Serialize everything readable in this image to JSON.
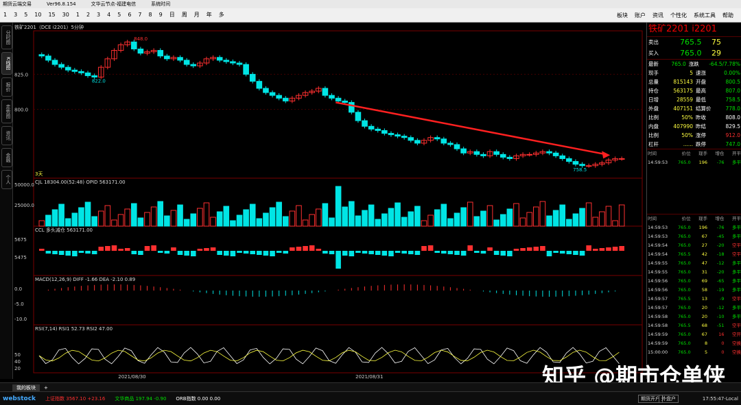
{
  "colors": {
    "up": "#ff3030",
    "down": "#00e5e5",
    "ma": "#ffffff",
    "yellow": "#ffff40",
    "bg": "#000000",
    "grid": "#7a0000"
  },
  "title": {
    "app": "期货云端交易",
    "version": "Ver96.8.154",
    "news": "文华云节点-福建电信",
    "sysinfo": "系统时间"
  },
  "toolbar": {
    "buttons": [
      "1",
      "3",
      "5",
      "10",
      "15",
      "30",
      "1",
      "2",
      "3",
      "4",
      "5",
      "6",
      "7",
      "8",
      "9",
      "日",
      "周",
      "月",
      "年",
      "多"
    ],
    "right": [
      "板块",
      "账户",
      "资讯",
      "个性化",
      "系统工具",
      "帮助"
    ]
  },
  "left_tabs": [
    "分时图",
    "K线图",
    "报价",
    "走势图",
    "资讯",
    "金融",
    "个人"
  ],
  "chart": {
    "instrument_label": "铁矿2201（DCE i2201）5分钟",
    "price_ticks": [
      "825.0",
      "800.0"
    ],
    "high_label": "848.0",
    "low_label": "822.0",
    "low2_label": "758.5",
    "bottom_label": "3天",
    "vol_header": "CJL    18304.00(52:48)  OPID 563171.00",
    "vol_ticks": [
      "50000.0",
      "25000.0"
    ],
    "ccl_header": "CCL    多头减仓    563171.00",
    "ccl_ticks": [
      "5675",
      "5475"
    ],
    "macd_header": "MACD(12,26,9)   DIFF -1.66   DEA -2.10   0.89",
    "macd_ticks": [
      "0.0",
      "-5.0",
      "-10.0"
    ],
    "rsi_header": "RSI(7,14)   RSI1 52.73   RSI2 47.00",
    "rsi_ticks": [
      "50",
      "40",
      "20"
    ],
    "dates": [
      "2021/08/30",
      "2021/08/31"
    ]
  },
  "chart_data": {
    "type": "candlestick",
    "note": "5-minute candles, i2201 iron ore",
    "price_range": [
      755,
      852
    ],
    "closes": [
      838,
      835,
      832,
      830,
      828,
      827,
      826,
      824,
      823,
      830,
      836,
      842,
      846,
      848,
      843,
      840,
      841,
      842,
      838,
      836,
      837,
      835,
      832,
      831,
      833,
      836,
      837,
      835,
      834,
      833,
      832,
      825,
      820,
      815,
      812,
      810,
      808,
      806,
      808,
      810,
      812,
      813,
      815,
      810,
      808,
      806,
      805,
      798,
      792,
      788,
      786,
      785,
      783,
      782,
      781,
      780,
      778,
      776,
      778,
      780,
      779,
      776,
      775,
      772,
      769,
      770,
      768,
      767,
      770,
      768,
      766,
      765,
      767,
      768,
      768,
      769,
      770,
      769,
      767,
      765,
      763,
      761,
      760,
      760,
      761,
      762,
      764,
      765,
      765
    ]
  },
  "right_panel": {
    "title": "铁矿2201   i2201",
    "sell": {
      "label": "卖出",
      "price": "765.5",
      "qty": "75"
    },
    "buy": {
      "label": "买入",
      "price": "765.0",
      "qty": "29"
    },
    "stats": [
      [
        "最新",
        "765.0",
        "涨跌",
        "-64.5/7.78%"
      ],
      [
        "现手",
        "5",
        "速涨",
        "0.00%"
      ],
      [
        "总量",
        "815143",
        "开盘",
        "800.5"
      ],
      [
        "持仓",
        "563175",
        "最高",
        "807.0"
      ],
      [
        "日增",
        "28559",
        "最低",
        "758.5"
      ],
      [
        "外盘",
        "407151",
        "结算价",
        "778.0"
      ],
      [
        "比例",
        "50%",
        "昨收",
        "808.0"
      ],
      [
        "内盘",
        "407990",
        "昨结",
        "829.5"
      ],
      [
        "比例",
        "50%",
        "涨停",
        "912.0"
      ],
      [
        "杠杆",
        "......",
        "跌停",
        "747.0"
      ]
    ],
    "trade_header": [
      "时间",
      "价位",
      "现手",
      "增仓",
      "开平"
    ],
    "top_trade": [
      "14:59:53",
      "765.0",
      "196",
      "-76",
      "多平"
    ],
    "trades": [
      [
        "14:59:53",
        "765.0",
        "196",
        "-76",
        "多平"
      ],
      [
        "14:59:53",
        "765.0",
        "67",
        "-45",
        "多平"
      ],
      [
        "14:59:54",
        "765.0",
        "27",
        "-20",
        "空平"
      ],
      [
        "14:59:54",
        "765.5",
        "42",
        "-18",
        "空平"
      ],
      [
        "14:59:55",
        "765.0",
        "47",
        "-12",
        "多平"
      ],
      [
        "14:59:55",
        "765.0",
        "31",
        "-20",
        "多平"
      ],
      [
        "14:59:56",
        "765.0",
        "69",
        "-65",
        "多平"
      ],
      [
        "14:59:56",
        "765.0",
        "58",
        "-19",
        "多平"
      ],
      [
        "14:59:57",
        "765.5",
        "13",
        "-9",
        "空平"
      ],
      [
        "14:59:57",
        "765.0",
        "20",
        "-12",
        "多平"
      ],
      [
        "14:59:58",
        "765.0",
        "20",
        "-10",
        "多平"
      ],
      [
        "14:59:58",
        "765.5",
        "68",
        "-51",
        "空平"
      ],
      [
        "14:59:59",
        "765.0",
        "67",
        "16",
        "空开"
      ],
      [
        "14:59:59",
        "765.0",
        "8",
        "0",
        "空换"
      ],
      [
        "15:00:00",
        "765.0",
        "5",
        "0",
        "空换"
      ]
    ]
  },
  "tabs": {
    "active": "我的板块",
    "add": "+"
  },
  "status": {
    "logo": "webstock",
    "sh": "上证指数  3567.10  +23.16",
    "wh": "文华商品  197.94  -0.90",
    "orb": "ORB指数  0.00  0.00",
    "btn1": "期货开户",
    "btn2": "外盘户",
    "time": "17:55:47-Local"
  },
  "watermark": "知乎 @期市仓单侠"
}
